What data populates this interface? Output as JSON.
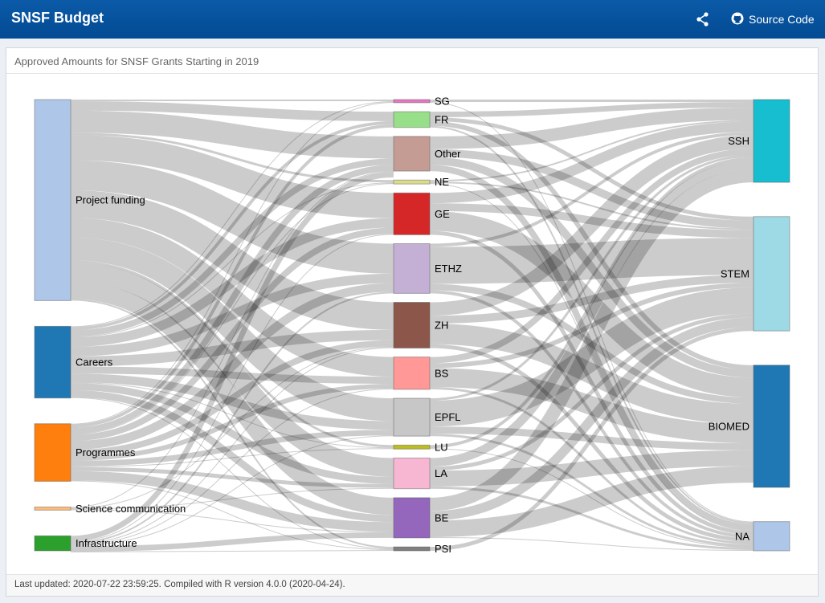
{
  "app": {
    "title": "SNSF Budget",
    "source_code_label": "Source Code",
    "share_icon": "share-icon",
    "github_icon": "github-icon"
  },
  "card": {
    "title": "Approved Amounts for SNSF Grants Starting in 2019",
    "footer": "Last updated: 2020-07-22 23:59:25. Compiled with R version 4.0.0 (2020-04-24)."
  },
  "chart_data": {
    "type": "sankey",
    "title": "Approved Amounts for SNSF Grants Starting in 2019",
    "columns": [
      [
        "Project funding",
        "Careers",
        "Programmes",
        "Science communication",
        "Infrastructure"
      ],
      [
        "SG",
        "FR",
        "Other",
        "NE",
        "GE",
        "ETHZ",
        "ZH",
        "BS",
        "EPFL",
        "LU",
        "LA",
        "BE",
        "PSI"
      ],
      [
        "SSH",
        "STEM",
        "BIOMED",
        "NA"
      ]
    ],
    "node_values": {
      "Project funding": 255,
      "Careers": 91,
      "Programmes": 73,
      "Science communication": 4,
      "Infrastructure": 19,
      "SG": 4,
      "FR": 20,
      "Other": 44,
      "NE": 5,
      "GE": 53,
      "ETHZ": 63,
      "ZH": 58,
      "BS": 41,
      "EPFL": 48,
      "LU": 5,
      "LA": 39,
      "BE": 51,
      "PSI": 5,
      "SSH": 105,
      "STEM": 145,
      "BIOMED": 155,
      "NA": 37
    },
    "node_colors": {
      "Project funding": "#aec7e8",
      "Careers": "#1f77b4",
      "Programmes": "#ff7f0e",
      "Science communication": "#ffbb78",
      "Infrastructure": "#2ca02c",
      "SG": "#e377c2",
      "FR": "#98df8a",
      "Other": "#c49c94",
      "NE": "#dbdb8d",
      "GE": "#d62728",
      "ETHZ": "#c5b0d5",
      "ZH": "#8c564b",
      "BS": "#ff9896",
      "EPFL": "#c7c7c7",
      "LU": "#bcbd22",
      "LA": "#f7b6d2",
      "BE": "#9467bd",
      "PSI": "#7f7f7f",
      "SSH": "#17becf",
      "STEM": "#9edae5",
      "BIOMED": "#1f77b4",
      "NA": "#aec7e8"
    },
    "link_color": "#bdbdbd",
    "links": [
      [
        "Project funding",
        "SG",
        2
      ],
      [
        "Project funding",
        "FR",
        12
      ],
      [
        "Project funding",
        "Other",
        28
      ],
      [
        "Project funding",
        "NE",
        3
      ],
      [
        "Project funding",
        "GE",
        32
      ],
      [
        "Project funding",
        "ETHZ",
        38
      ],
      [
        "Project funding",
        "ZH",
        35
      ],
      [
        "Project funding",
        "BS",
        25
      ],
      [
        "Project funding",
        "EPFL",
        29
      ],
      [
        "Project funding",
        "LU",
        3
      ],
      [
        "Project funding",
        "LA",
        24
      ],
      [
        "Project funding",
        "BE",
        22
      ],
      [
        "Project funding",
        "PSI",
        2
      ],
      [
        "Careers",
        "SG",
        1
      ],
      [
        "Careers",
        "FR",
        4
      ],
      [
        "Careers",
        "Other",
        8
      ],
      [
        "Careers",
        "NE",
        1
      ],
      [
        "Careers",
        "GE",
        12
      ],
      [
        "Careers",
        "ETHZ",
        12
      ],
      [
        "Careers",
        "ZH",
        13
      ],
      [
        "Careers",
        "BS",
        9
      ],
      [
        "Careers",
        "EPFL",
        11
      ],
      [
        "Careers",
        "LU",
        1
      ],
      [
        "Careers",
        "LA",
        9
      ],
      [
        "Careers",
        "BE",
        9
      ],
      [
        "Careers",
        "PSI",
        1
      ],
      [
        "Programmes",
        "SG",
        1
      ],
      [
        "Programmes",
        "FR",
        4
      ],
      [
        "Programmes",
        "Other",
        8
      ],
      [
        "Programmes",
        "NE",
        1
      ],
      [
        "Programmes",
        "GE",
        8
      ],
      [
        "Programmes",
        "ETHZ",
        11
      ],
      [
        "Programmes",
        "ZH",
        8
      ],
      [
        "Programmes",
        "BS",
        6
      ],
      [
        "Programmes",
        "EPFL",
        7
      ],
      [
        "Programmes",
        "LU",
        1
      ],
      [
        "Programmes",
        "LA",
        5
      ],
      [
        "Programmes",
        "BE",
        12
      ],
      [
        "Programmes",
        "PSI",
        1
      ],
      [
        "Science communication",
        "Other",
        1
      ],
      [
        "Science communication",
        "ZH",
        1
      ],
      [
        "Science communication",
        "LA",
        1
      ],
      [
        "Science communication",
        "BE",
        1
      ],
      [
        "Infrastructure",
        "ETHZ",
        2
      ],
      [
        "Infrastructure",
        "ZH",
        1
      ],
      [
        "Infrastructure",
        "BS",
        1
      ],
      [
        "Infrastructure",
        "EPFL",
        1
      ],
      [
        "Infrastructure",
        "BE",
        7
      ],
      [
        "Infrastructure",
        "GE",
        1
      ],
      [
        "Infrastructure",
        "Other",
        7
      ],
      [
        "Infrastructure",
        "PSI",
        1
      ],
      [
        "SG",
        "SSH",
        3
      ],
      [
        "SG",
        "NA",
        1
      ],
      [
        "FR",
        "SSH",
        7
      ],
      [
        "FR",
        "STEM",
        5
      ],
      [
        "FR",
        "BIOMED",
        6
      ],
      [
        "FR",
        "NA",
        2
      ],
      [
        "Other",
        "SSH",
        16
      ],
      [
        "Other",
        "STEM",
        10
      ],
      [
        "Other",
        "BIOMED",
        10
      ],
      [
        "Other",
        "NA",
        8
      ],
      [
        "NE",
        "SSH",
        2
      ],
      [
        "NE",
        "STEM",
        2
      ],
      [
        "NE",
        "NA",
        1
      ],
      [
        "GE",
        "SSH",
        13
      ],
      [
        "GE",
        "STEM",
        10
      ],
      [
        "GE",
        "BIOMED",
        25
      ],
      [
        "GE",
        "NA",
        5
      ],
      [
        "ETHZ",
        "SSH",
        4
      ],
      [
        "ETHZ",
        "STEM",
        47
      ],
      [
        "ETHZ",
        "BIOMED",
        8
      ],
      [
        "ETHZ",
        "NA",
        4
      ],
      [
        "ZH",
        "SSH",
        17
      ],
      [
        "ZH",
        "STEM",
        10
      ],
      [
        "ZH",
        "BIOMED",
        26
      ],
      [
        "ZH",
        "NA",
        5
      ],
      [
        "BS",
        "SSH",
        8
      ],
      [
        "BS",
        "STEM",
        6
      ],
      [
        "BS",
        "BIOMED",
        24
      ],
      [
        "BS",
        "NA",
        3
      ],
      [
        "EPFL",
        "SSH",
        3
      ],
      [
        "EPFL",
        "STEM",
        33
      ],
      [
        "EPFL",
        "BIOMED",
        9
      ],
      [
        "EPFL",
        "NA",
        3
      ],
      [
        "LU",
        "SSH",
        4
      ],
      [
        "LU",
        "NA",
        1
      ],
      [
        "LA",
        "SSH",
        11
      ],
      [
        "LA",
        "STEM",
        5
      ],
      [
        "LA",
        "BIOMED",
        20
      ],
      [
        "LA",
        "NA",
        3
      ],
      [
        "BE",
        "SSH",
        17
      ],
      [
        "BE",
        "STEM",
        12
      ],
      [
        "BE",
        "BIOMED",
        21
      ],
      [
        "BE",
        "NA",
        1
      ],
      [
        "PSI",
        "STEM",
        5
      ]
    ]
  }
}
